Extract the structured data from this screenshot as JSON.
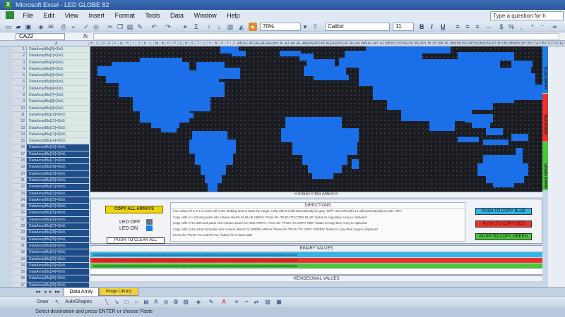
{
  "window": {
    "title": "Microsoft Excel - LED GLOBE 82"
  },
  "menu": {
    "items": [
      "File",
      "Edit",
      "View",
      "Insert",
      "Format",
      "Tools",
      "Data",
      "Window",
      "Help"
    ],
    "help_placeholder": "Type a question for h"
  },
  "toolbar": {
    "zoom": "70%",
    "font": "Calibri",
    "font_size": "11"
  },
  "formula_bar": {
    "cell_ref": "CA22",
    "fx": "fx"
  },
  "array_rows": [
    "DataArrayBlu[0]={0x0,",
    "DataArrayBlu[1]={0x0,",
    "DataArrayBlu[2]={0x0,",
    "DataArrayBlu[3]={0x0,",
    "DataArrayBlu[4]={0x0,",
    "DataArrayBlu[5]={0x0,",
    "DataArrayBlu[6]={0x0,",
    "DataArrayBlu[7]={0x0,",
    "DataArrayBlu[8]={0x0,",
    "DataArrayBlu[9]={0x0,",
    "DataArrayBlu[10]={0x0,",
    "DataArrayBlu[11]={0x0,",
    "DataArrayBlu[12]={0x0,",
    "DataArrayBlu[13]={0x0,",
    "DataArrayBlu[14]={0x0,",
    "DataArrayBlu[15]={0x0,",
    "DataArrayBlu[16]={0x0,",
    "DataArrayBlu[17]={0x0,",
    "DataArrayBlu[18]={0x0,",
    "DataArrayBlu[19]={0x0,",
    "DataArrayBlu[20]={0x0,",
    "DataArrayBlu[21]={0x0,",
    "DataArrayBlu[22]={0x0,",
    "DataArrayBlu[23]={0x0,",
    "DataArrayBlu[24]={0x0,",
    "DataArrayBlu[25]={0x0,",
    "DataArrayBlu[26]={0x0,",
    "DataArrayBlu[27]={0x0,",
    "DataArrayBlu[28]={0x0,",
    "DataArrayBlu[29]={0x0,",
    "DataArrayBlu[30]={0x0,",
    "DataArrayBlu[31]={0x0,",
    "DataArrayBlu[32]={0x0,",
    "DataArrayBlu[33]={0x0,",
    "DataArrayBlu[34]={0x0,",
    "DataArrayBlu[35]={0x0,",
    "DataArrayBlu[36]={0x0,"
  ],
  "drafting": {
    "label": "<<DRAFTING AREA>>"
  },
  "side_strips": {
    "blue": "BLUE ARRAY",
    "red": "RED ARRAY",
    "green": "GREEN ARRAY"
  },
  "panel": {
    "copy_all": "COPY ALL ARRAYS",
    "led_off": "LED  OFF",
    "led_on": "LED  ON",
    "clear_all": "PUSH TO CLEAR ALL",
    "directions_title": "DIRECTIONS",
    "directions": [
      "Use values of 0 or 1 in each cell of the drafting area to draw the image. Cells with a 0 will automatically be gray \"OFF\" and cells with a 1 will automatically be blue \"ON\".",
      "Copy cells A1-A78 and paste into Arduino sketch for BLUE ARRAY.   Press the \"PUSH TO COPY BLUE\" button to copy Blue Array to clipboard",
      "Copy cells A79-A160 and paste into Arduino sketch for RED ARRAY.   Press the \"PUSH TO COPY RED\" button to copy Blue Array to clipboard",
      "Copy cells A161-A240 and paste into Arduino sketch for GREEN ARRAY.   Press the \"PUSH TO COPY GREEN\" button to copy Blue Array to clipboard",
      "Press the \"PUSH TO CLEAR ALL\" button for a clean slate"
    ],
    "copy_blue": "PUSH TO COPY BLUE",
    "copy_red": "PUSH TO COPY RED",
    "copy_green": "PUSH TO COPY GREEN"
  },
  "binary": {
    "title": "BINARY VALUES",
    "blue_row": "0000000000000000000000000000000000000000000000000000000000000000000000000000000000000000000000000000000000000000000000000000000000",
    "red_row": "0000000000000000000000000000000000000000000000000000000000000000000000000000000000000000000000000000000000000000000000000000000000",
    "green_row": "0000000000000000000000000000000000000000000000000000000000000000000000000000000000000000000000000000000000000000000000000000000000"
  },
  "hex": {
    "title": "HEXIDECIMAL VALUES"
  },
  "tabs": {
    "data_array": "Data Array",
    "image_library": "Image Library"
  },
  "drawing_toolbar": {
    "draw": "Draw",
    "autoshapes": "AutoShapes"
  },
  "status": {
    "text": "Select destination and press ENTER or choose Paste"
  },
  "colors": {
    "led_on": "#1b6fe8",
    "led_off": "#3a3d45",
    "blue": "#33b3e6",
    "red": "#e8332b",
    "green": "#4cc43e",
    "yellow": "#f0d400"
  }
}
